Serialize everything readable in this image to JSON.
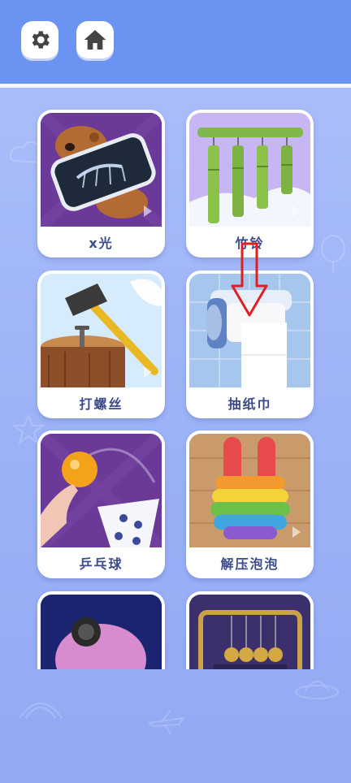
{
  "header": {
    "settings_icon": "gear-icon",
    "home_icon": "home-icon"
  },
  "games": [
    {
      "label": "x光"
    },
    {
      "label": "竹铃"
    },
    {
      "label": "打螺丝"
    },
    {
      "label": "抽纸巾"
    },
    {
      "label": "乒乓球"
    },
    {
      "label": "解压泡泡"
    },
    {
      "label": ""
    },
    {
      "label": ""
    }
  ],
  "colors": {
    "header_bg": "#6b93f1",
    "page_bg": "#9ab0f6",
    "label_text": "#3b4a8a",
    "arrow": "#e02020"
  }
}
